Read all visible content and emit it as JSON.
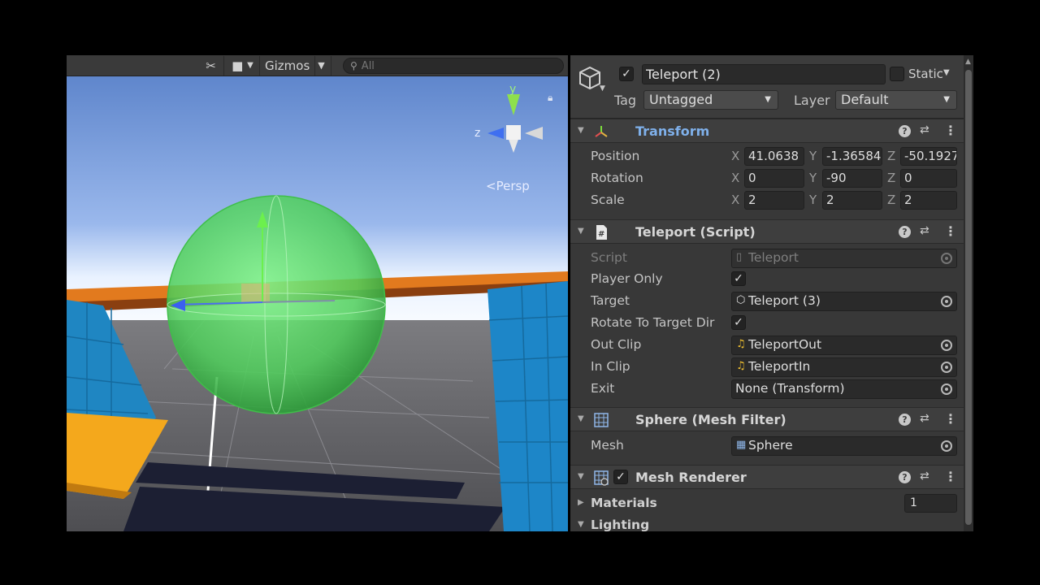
{
  "scene": {
    "toolbar": {
      "gizmos_label": "Gizmos",
      "search_placeholder": "All"
    },
    "orientation_gizmo": {
      "y_label": "y",
      "z_label": "z",
      "projection_label": "Persp"
    },
    "colors": {
      "sky": "#6f94d4",
      "trigger_sphere": "#5fd86a",
      "wall": "#1f86c2",
      "platform": "#f4a81c"
    }
  },
  "inspector": {
    "header": {
      "active": true,
      "name": "Teleport (2)",
      "static_label": "Static",
      "tag_label": "Tag",
      "tag_value": "Untagged",
      "layer_label": "Layer",
      "layer_value": "Default"
    },
    "transform": {
      "title": "Transform",
      "position_label": "Position",
      "rotation_label": "Rotation",
      "scale_label": "Scale",
      "axis_x": "X",
      "axis_y": "Y",
      "axis_z": "Z",
      "position": {
        "x": "41.0638",
        "y": "-1.36584",
        "z": "-50.1927"
      },
      "rotation": {
        "x": "0",
        "y": "-90",
        "z": "0"
      },
      "scale": {
        "x": "2",
        "y": "2",
        "z": "2"
      }
    },
    "teleport_script": {
      "title": "Teleport (Script)",
      "script_label": "Script",
      "script_value": "Teleport",
      "player_only_label": "Player Only",
      "player_only": true,
      "target_label": "Target",
      "target_value": "Teleport (3)",
      "rotate_label": "Rotate To Target Dir",
      "rotate": true,
      "out_clip_label": "Out Clip",
      "out_clip_value": "TeleportOut",
      "in_clip_label": "In Clip",
      "in_clip_value": "TeleportIn",
      "exit_label": "Exit",
      "exit_value": "None (Transform)"
    },
    "mesh_filter": {
      "title": "Sphere (Mesh Filter)",
      "mesh_label": "Mesh",
      "mesh_value": "Sphere"
    },
    "mesh_renderer": {
      "title": "Mesh Renderer",
      "enabled": true,
      "materials_label": "Materials",
      "materials_count": "1",
      "lighting_label": "Lighting"
    }
  }
}
